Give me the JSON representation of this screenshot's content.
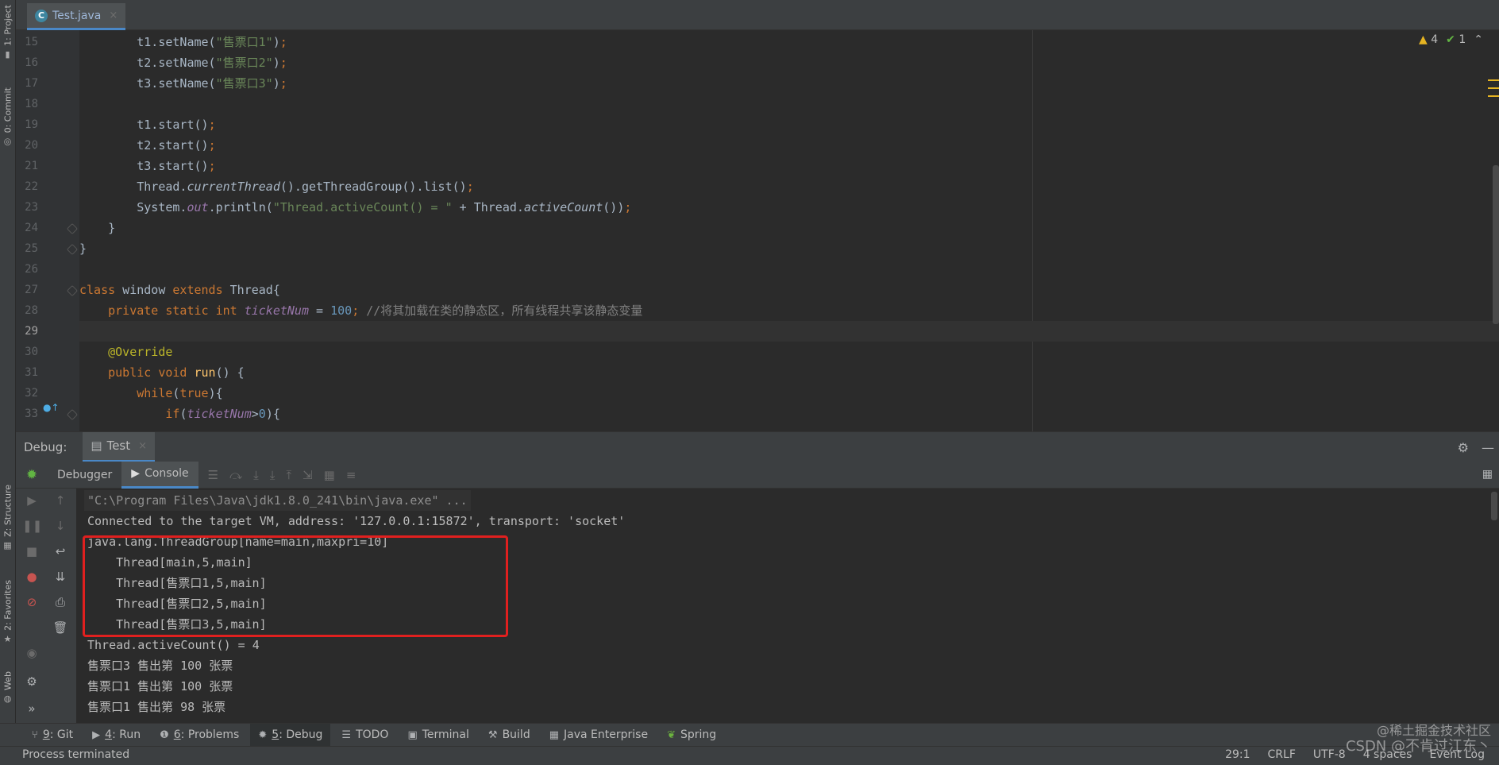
{
  "left_strip": {
    "project": "1: Project",
    "commit": "0: Commit",
    "structure": "Z: Structure",
    "favorites": "2: Favorites",
    "web": "Web"
  },
  "editor": {
    "tab_label": "Test.java",
    "inspections": {
      "warnings": "4",
      "checks": "1"
    },
    "lines": [
      {
        "n": "15",
        "text": "t1.setName(\"售票口1\");"
      },
      {
        "n": "16",
        "text": "t2.setName(\"售票口2\");"
      },
      {
        "n": "17",
        "text": "t3.setName(\"售票口3\");"
      },
      {
        "n": "18",
        "text": ""
      },
      {
        "n": "19",
        "text": "t1.start();"
      },
      {
        "n": "20",
        "text": "t2.start();"
      },
      {
        "n": "21",
        "text": "t3.start();"
      },
      {
        "n": "22",
        "text": "Thread.currentThread().getThreadGroup().list();"
      },
      {
        "n": "23",
        "text": "System.out.println(\"Thread.activeCount() = \" + Thread.activeCount());"
      },
      {
        "n": "24",
        "text": "}"
      },
      {
        "n": "25",
        "text": "}"
      },
      {
        "n": "26",
        "text": ""
      },
      {
        "n": "27",
        "text": "class window extends Thread{"
      },
      {
        "n": "28",
        "text": "private static int ticketNum = 100; //将其加载在类的静态区，所有线程共享该静态变量"
      },
      {
        "n": "29",
        "text": ""
      },
      {
        "n": "30",
        "text": "@Override"
      },
      {
        "n": "31",
        "text": "public void run() {"
      },
      {
        "n": "32",
        "text": "while(true){"
      },
      {
        "n": "33",
        "text": "if(ticketNum>0){"
      }
    ]
  },
  "debug": {
    "title": "Debug:",
    "run_tab": "Test",
    "subtabs": {
      "debugger": "Debugger",
      "console": "Console"
    },
    "console_lines": [
      "\"C:\\Program Files\\Java\\jdk1.8.0_241\\bin\\java.exe\" ...",
      "Connected to the target VM, address: '127.0.0.1:15872', transport: 'socket'",
      "java.lang.ThreadGroup[name=main,maxpri=10]",
      "    Thread[main,5,main]",
      "    Thread[售票口1,5,main]",
      "    Thread[售票口2,5,main]",
      "    Thread[售票口3,5,main]",
      "Thread.activeCount() = 4",
      "售票口3 售出第 100 张票",
      "售票口1 售出第 100 张票",
      "售票口1 售出第 98 张票"
    ]
  },
  "bottom_bar": {
    "items": [
      {
        "key": "9",
        "label": ": Git",
        "icon": "git-icon"
      },
      {
        "key": "4",
        "label": ": Run",
        "icon": "run-icon"
      },
      {
        "key": "6",
        "label": ": Problems",
        "icon": "problems-icon"
      },
      {
        "key": "5",
        "label": ": Debug",
        "icon": "debug-icon"
      },
      {
        "key": "",
        "label": "TODO",
        "icon": "todo-icon"
      },
      {
        "key": "",
        "label": "Terminal",
        "icon": "terminal-icon"
      },
      {
        "key": "",
        "label": "Build",
        "icon": "build-icon"
      },
      {
        "key": "",
        "label": "Java Enterprise",
        "icon": "java-enterprise-icon"
      },
      {
        "key": "",
        "label": "Spring",
        "icon": "spring-icon"
      }
    ]
  },
  "status_bar": {
    "text": "Process terminated",
    "position": "29:1",
    "line_separator": "CRLF",
    "encoding": "UTF-8",
    "indent": "4 spaces",
    "event_log": "Event Log"
  },
  "watermark": {
    "line1": "@稀土掘金技术社区",
    "line2": "CSDN @不肯过江东丶"
  }
}
